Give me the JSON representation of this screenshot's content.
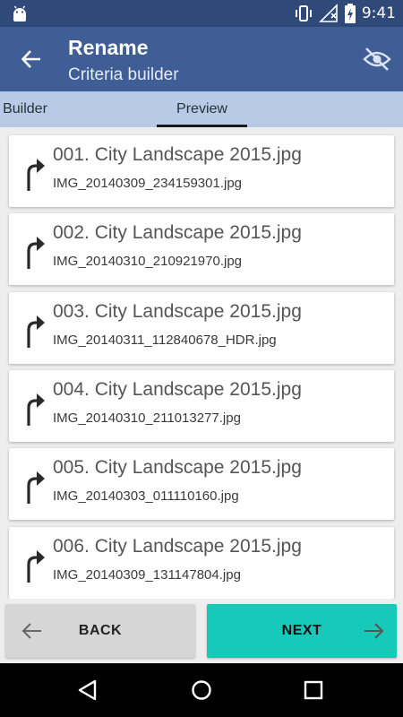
{
  "status_bar": {
    "time": "9:41",
    "icons": [
      "android-icon",
      "vibrate-icon",
      "wifi-off-icon",
      "battery-charging-icon"
    ]
  },
  "app_bar": {
    "title": "Rename",
    "subtitle": "Criteria builder",
    "back_icon": "arrow-back-icon",
    "action_icon": "visibility-off-icon"
  },
  "tabs": [
    {
      "label": "Builder",
      "selected": false
    },
    {
      "label": "Preview",
      "selected": true
    }
  ],
  "files": [
    {
      "new_name": "001. City Landscape 2015.jpg",
      "old_name": "IMG_20140309_234159301.jpg"
    },
    {
      "new_name": "002. City Landscape 2015.jpg",
      "old_name": "IMG_20140310_210921970.jpg"
    },
    {
      "new_name": "003. City Landscape 2015.jpg",
      "old_name": "IMG_20140311_112840678_HDR.jpg"
    },
    {
      "new_name": "004. City Landscape 2015.jpg",
      "old_name": "IMG_20140310_211013277.jpg"
    },
    {
      "new_name": "005. City Landscape 2015.jpg",
      "old_name": "IMG_20140303_011110160.jpg"
    },
    {
      "new_name": "006. City Landscape 2015.jpg",
      "old_name": "IMG_20140309_131147804.jpg"
    }
  ],
  "footer": {
    "back_label": "BACK",
    "next_label": "NEXT"
  },
  "colors": {
    "status_bar": "#2f4a78",
    "app_bar": "#3e5e95",
    "tab_bar": "#b7cbe6",
    "next_button": "#16c9b8",
    "back_button": "#d6d6d6"
  },
  "nav_icons": [
    "nav-back-icon",
    "nav-home-icon",
    "nav-recents-icon"
  ]
}
